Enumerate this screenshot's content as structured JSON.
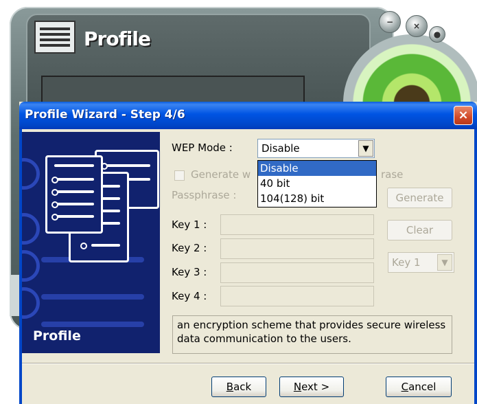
{
  "background_app": {
    "title": "Profile",
    "buttons": [
      "−",
      "×",
      "●"
    ]
  },
  "dialog": {
    "title": "Profile Wizard - Step 4/6",
    "close_glyph": "×"
  },
  "banner": {
    "label": "Profile"
  },
  "form": {
    "wep_mode_label": "WEP Mode :",
    "wep_mode_value": "Disable",
    "wep_mode_options": [
      "Disable",
      "40 bit",
      "104(128) bit"
    ],
    "generate_checkbox_label_start": "Generate w",
    "generate_checkbox_label_end": "rase",
    "passphrase_label": "Passphrase :",
    "generate_button": "Generate",
    "clear_button": "Clear",
    "key1_label": "Key 1 :",
    "key2_label": "Key 2 :",
    "key3_label": "Key 3 :",
    "key4_label": "Key 4 :",
    "default_key_value": "Key 1",
    "description": "an encryption scheme that provides secure wireless data communication to the users."
  },
  "footer": {
    "back_button": "Back",
    "back_accel": "B",
    "back_rest": "ack",
    "next_button": "Next >",
    "next_accel": "N",
    "next_rest": "ext >",
    "cancel_button": "Cancel",
    "cancel_accel": "C",
    "cancel_rest": "ancel"
  },
  "colors": {
    "titlebar": "#0054e3",
    "selection": "#316ac5",
    "banner": "#11226e",
    "dialog_bg": "#ece9d8"
  }
}
